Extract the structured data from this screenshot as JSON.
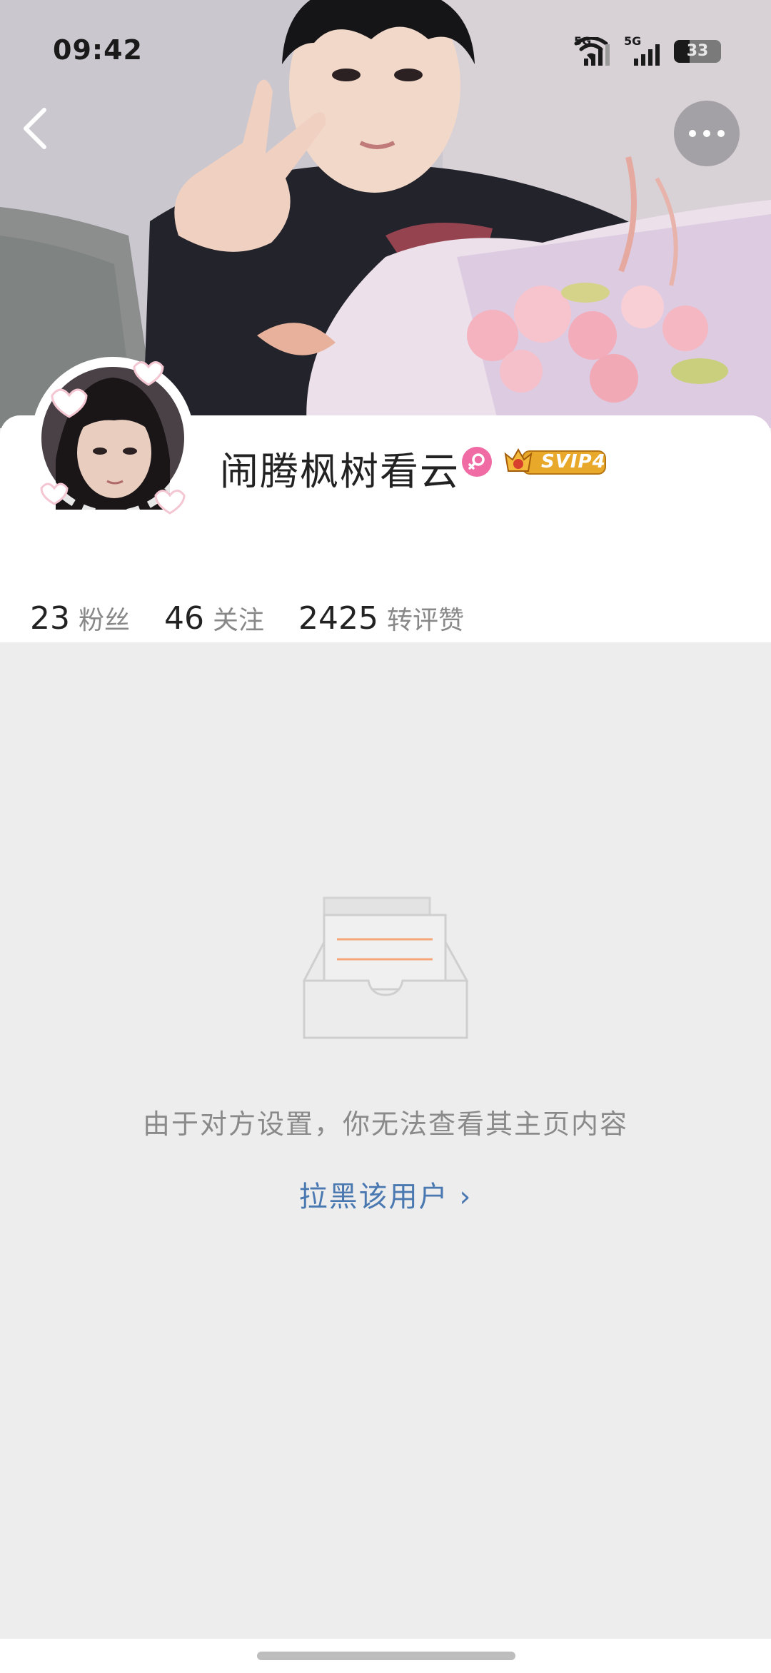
{
  "status_bar": {
    "time": "09:42",
    "signal_1": "5G",
    "signal_2": "5G",
    "battery": "33"
  },
  "nav": {
    "back_icon": "chevron-left-icon",
    "more_icon": "more-horizontal-icon"
  },
  "profile": {
    "username": "闹腾枫树看云",
    "gender": "female",
    "vip_label": "SVIP4",
    "stats": [
      {
        "value": "23",
        "label": "粉丝"
      },
      {
        "value": "46",
        "label": "关注"
      },
      {
        "value": "2425",
        "label": "转评赞"
      }
    ]
  },
  "empty_state": {
    "message": "由于对方设置，你无法查看其主页内容",
    "block_link": "拉黑该用户 ›"
  },
  "colors": {
    "link": "#4a78b0",
    "gender_badge": "#f06aa4",
    "vip_gold": "#e8a92b",
    "illus_accent": "#f5a77a"
  }
}
